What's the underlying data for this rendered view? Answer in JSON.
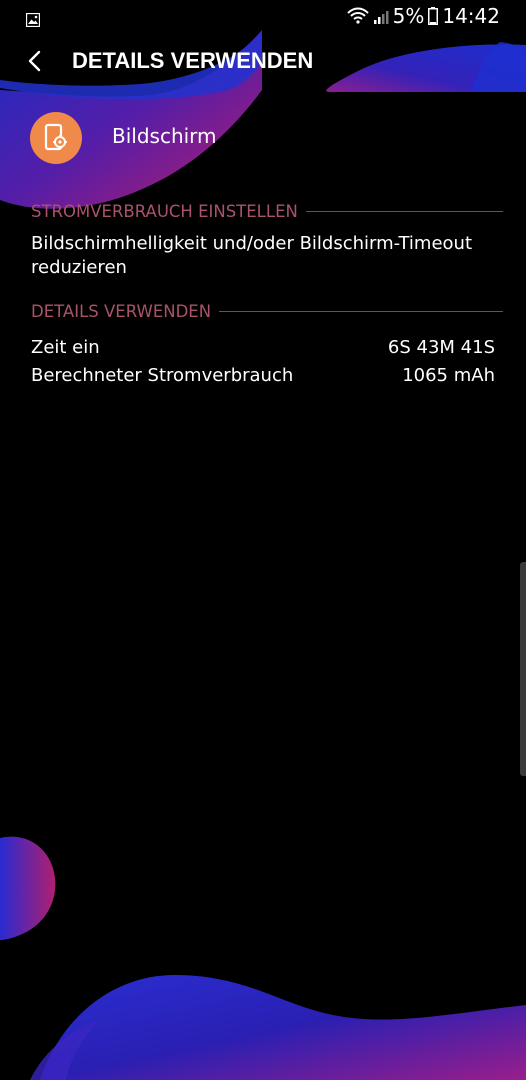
{
  "status_bar": {
    "battery_percent": "5%",
    "time": "14:42",
    "icons": [
      "gallery-icon",
      "wifi-icon",
      "signal-icon",
      "battery-icon"
    ]
  },
  "app_bar": {
    "title": "DETAILS VERWENDEN",
    "back_icon": "chevron-left-icon"
  },
  "app": {
    "name": "Bildschirm",
    "icon": "screen-settings-icon",
    "icon_color": "#F08A4B"
  },
  "power_section": {
    "header": "STROMVERBRAUCH EINSTELLEN",
    "tip": "Bildschirmhelligkeit und/oder Bildschirm-Timeout reduzieren"
  },
  "details_section": {
    "header": "DETAILS VERWENDEN",
    "rows": [
      {
        "label": "Zeit ein",
        "value": "6S 43M 41S"
      },
      {
        "label": "Berechneter Stromverbrauch",
        "value": "1065 mAh"
      }
    ]
  },
  "colors": {
    "background": "#000000",
    "section_header": "#A8536A",
    "accent_blue": "#1F2DBF",
    "accent_magenta": "#B0207A"
  }
}
